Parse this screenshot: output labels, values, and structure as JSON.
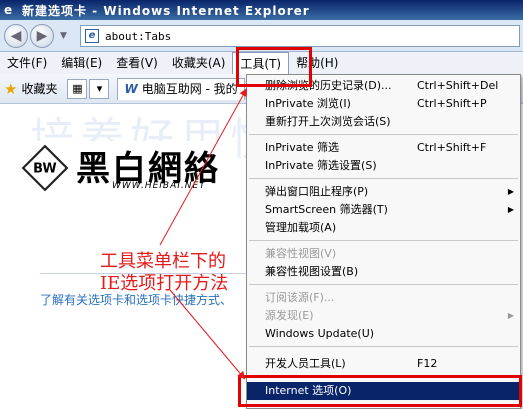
{
  "window": {
    "title": "新建选项卡 - Windows Internet Explorer"
  },
  "address": {
    "url": "about:Tabs"
  },
  "menubar": {
    "items": [
      "文件(F)",
      "编辑(E)",
      "查看(V)",
      "收藏夹(A)",
      "工具(T)",
      "帮助(H)"
    ]
  },
  "favbar": {
    "favorites_label": "收藏夹",
    "tab_label": "电脑互助网 - 我的"
  },
  "content": {
    "watermark": "培养好用惯",
    "logo_brand": "黑白網絡",
    "logo_url": "WWW.HEIBAI.NET",
    "annotation_line1": "工具菜单栏下的",
    "annotation_line2": "IE选项打开方法",
    "learn_link": "了解有关选项卡和选项卡快捷方式、"
  },
  "tools_menu": {
    "items": [
      {
        "label": "删除浏览的历史记录(D)...",
        "shortcut": "Ctrl+Shift+Del"
      },
      {
        "label": "InPrivate 浏览(I)",
        "shortcut": "Ctrl+Shift+P"
      },
      {
        "label": "重新打开上次浏览会话(S)",
        "shortcut": ""
      },
      {
        "label": "InPrivate 筛选",
        "shortcut": "Ctrl+Shift+F"
      },
      {
        "label": "InPrivate 筛选设置(S)",
        "shortcut": ""
      },
      {
        "label": "弹出窗口阻止程序(P)",
        "shortcut": ""
      },
      {
        "label": "SmartScreen 筛选器(T)",
        "shortcut": ""
      },
      {
        "label": "管理加载项(A)",
        "shortcut": ""
      },
      {
        "label": "兼容性视图(V)",
        "shortcut": ""
      },
      {
        "label": "兼容性视图设置(B)",
        "shortcut": ""
      },
      {
        "label": "订阅该源(F)...",
        "shortcut": ""
      },
      {
        "label": "源发现(E)",
        "shortcut": ""
      },
      {
        "label": "Windows Update(U)",
        "shortcut": ""
      },
      {
        "label": "开发人员工具(L)",
        "shortcut": "F12"
      },
      {
        "label": "Internet 选项(O)",
        "shortcut": ""
      }
    ]
  },
  "colors": {
    "highlight": "#0a246a",
    "annotation": "#e51b1b"
  }
}
